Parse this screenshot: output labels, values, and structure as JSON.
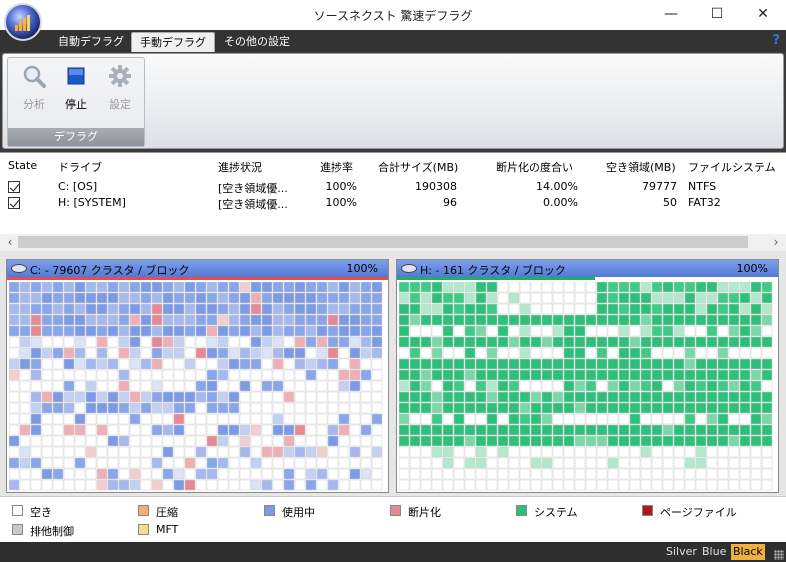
{
  "window": {
    "title": "ソースネクスト 驚速デフラグ",
    "controls": [
      "minimize-icon",
      "maximize-icon",
      "close-icon"
    ]
  },
  "tabs": [
    {
      "label": "自動デフラグ",
      "active": false
    },
    {
      "label": "手動デフラグ",
      "active": true
    },
    {
      "label": "その他の設定",
      "active": false
    }
  ],
  "help": {
    "label": "?"
  },
  "ribbon": {
    "group_label": "デフラグ",
    "buttons": [
      {
        "label": "分析",
        "icon": "magnifier-icon",
        "enabled": false
      },
      {
        "label": "停止",
        "icon": "stop-icon",
        "enabled": true
      },
      {
        "label": "設定",
        "icon": "gear-icon",
        "enabled": false
      }
    ]
  },
  "drive_list": {
    "columns": [
      "State",
      "ドライブ",
      "進捗状況",
      "進捗率",
      "合計サイズ(MB)",
      "断片化の度合い",
      "空き領域(MB)",
      "ファイルシステム"
    ],
    "rows": [
      {
        "checked": true,
        "drive": "C: [OS]",
        "status": "[空き領域優...",
        "progress": "100%",
        "total": "190308",
        "fragmentation": "14.00%",
        "free": "79777",
        "fs": "NTFS"
      },
      {
        "checked": true,
        "drive": "H: [SYSTEM]",
        "status": "[空き領域優...",
        "progress": "100%",
        "total": "96",
        "fragmentation": "0.00%",
        "free": "50",
        "fs": "FAT32"
      }
    ]
  },
  "maps": [
    {
      "title": "C: - 79607 クラスタ / ブロック",
      "percent": "100%",
      "progress_color": "#e05050",
      "progress": 1.0
    },
    {
      "title": "H: - 161 クラスタ / ブロック",
      "percent": "100%",
      "progress_color": "#20b060",
      "progress": 0.52
    }
  ],
  "legend": [
    {
      "label": "空き",
      "color": "#ffffff"
    },
    {
      "label": "圧縮",
      "color": "#f5b070"
    },
    {
      "label": "使用中",
      "color": "#7d9ae6"
    },
    {
      "label": "断片化",
      "color": "#e58a94"
    },
    {
      "label": "システム",
      "color": "#2ec07a"
    },
    {
      "label": "ページファイル",
      "color": "#b01818"
    },
    {
      "label": "排他制御",
      "color": "#c8c8c8"
    },
    {
      "label": "MFT",
      "color": "#f5dc90"
    }
  ],
  "skins": [
    {
      "label": "Silver",
      "active": false
    },
    {
      "label": "Blue",
      "active": false
    },
    {
      "label": "Black",
      "active": true
    }
  ]
}
